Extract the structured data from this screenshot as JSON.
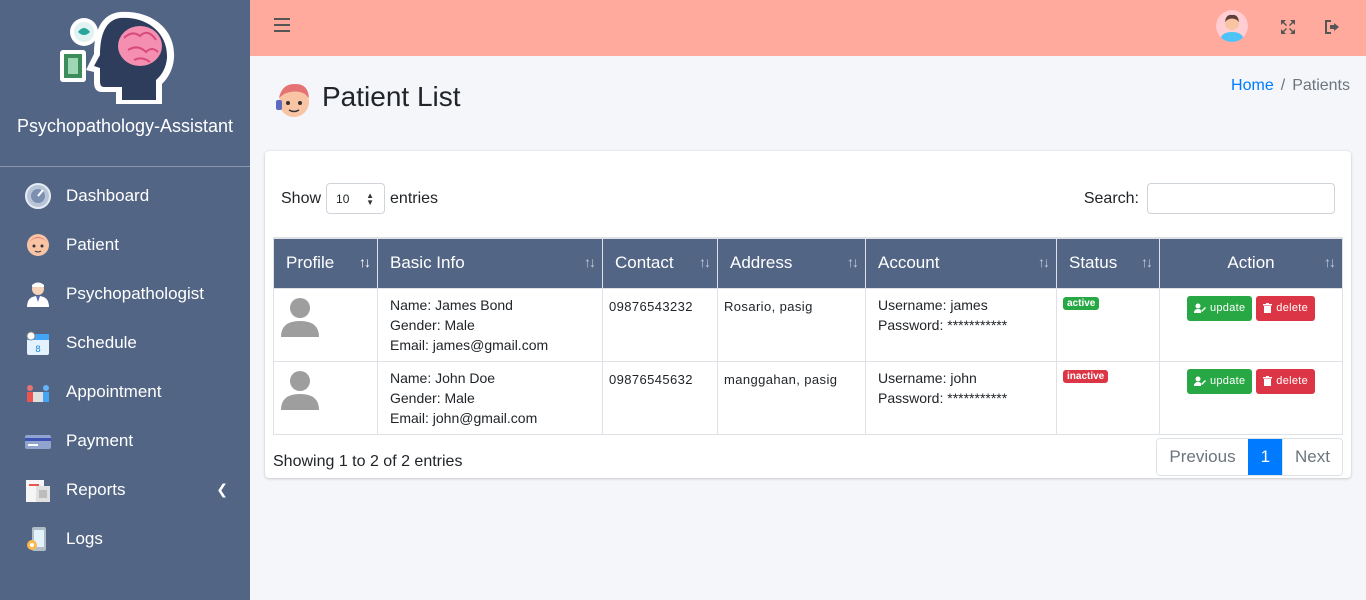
{
  "app": {
    "brand_name": "Psychopathology-Assistant"
  },
  "sidebar": {
    "items": [
      {
        "label": "Dashboard",
        "icon": "dashboard-icon"
      },
      {
        "label": "Patient",
        "icon": "patient-icon"
      },
      {
        "label": "Psychopathologist",
        "icon": "doctor-icon"
      },
      {
        "label": "Schedule",
        "icon": "calendar-icon"
      },
      {
        "label": "Appointment",
        "icon": "appointment-icon"
      },
      {
        "label": "Payment",
        "icon": "payment-icon"
      },
      {
        "label": "Reports",
        "icon": "reports-icon",
        "has_submenu": true
      },
      {
        "label": "Logs",
        "icon": "logs-icon"
      }
    ]
  },
  "topbar": {
    "menu_icon": "hamburger-icon",
    "avatar_icon": "user-avatar-icon",
    "fullscreen_icon": "expand-icon",
    "logout_icon": "logout-icon"
  },
  "page": {
    "title": "Patient List",
    "breadcrumb": {
      "home": "Home",
      "separator": "/",
      "current": "Patients"
    }
  },
  "table_controls": {
    "show_label": "Show",
    "entries_value": "10",
    "entries_label": "entries",
    "search_label": "Search:",
    "search_value": ""
  },
  "table": {
    "columns": [
      "Profile",
      "Basic Info",
      "Contact",
      "Address",
      "Account",
      "Status",
      "Action"
    ],
    "rows": [
      {
        "name": "Name: James Bond",
        "gender": "Gender: Male",
        "email": "Email: james@gmail.com",
        "contact": "09876543232",
        "address": "Rosario, pasig",
        "username": "Username: james",
        "password": "Password: ***********",
        "status": "active",
        "update_label": "update",
        "delete_label": "delete"
      },
      {
        "name": "Name: John Doe",
        "gender": "Gender: Male",
        "email": "Email: john@gmail.com",
        "contact": "09876545632",
        "address": "manggahan, pasig",
        "username": "Username: john",
        "password": "Password: ***********",
        "status": "inactive",
        "update_label": "update",
        "delete_label": "delete"
      }
    ]
  },
  "footer": {
    "info": "Showing 1 to 2 of 2 entries",
    "pagination": {
      "previous": "Previous",
      "current": "1",
      "next": "Next"
    }
  },
  "colors": {
    "sidebar_bg": "#536585",
    "topbar_bg": "#ffaa9d",
    "active_badge": "#28a745",
    "inactive_badge": "#dc3545",
    "update_button": "#28a745",
    "delete_button": "#dc3545",
    "primary": "#007bff"
  }
}
